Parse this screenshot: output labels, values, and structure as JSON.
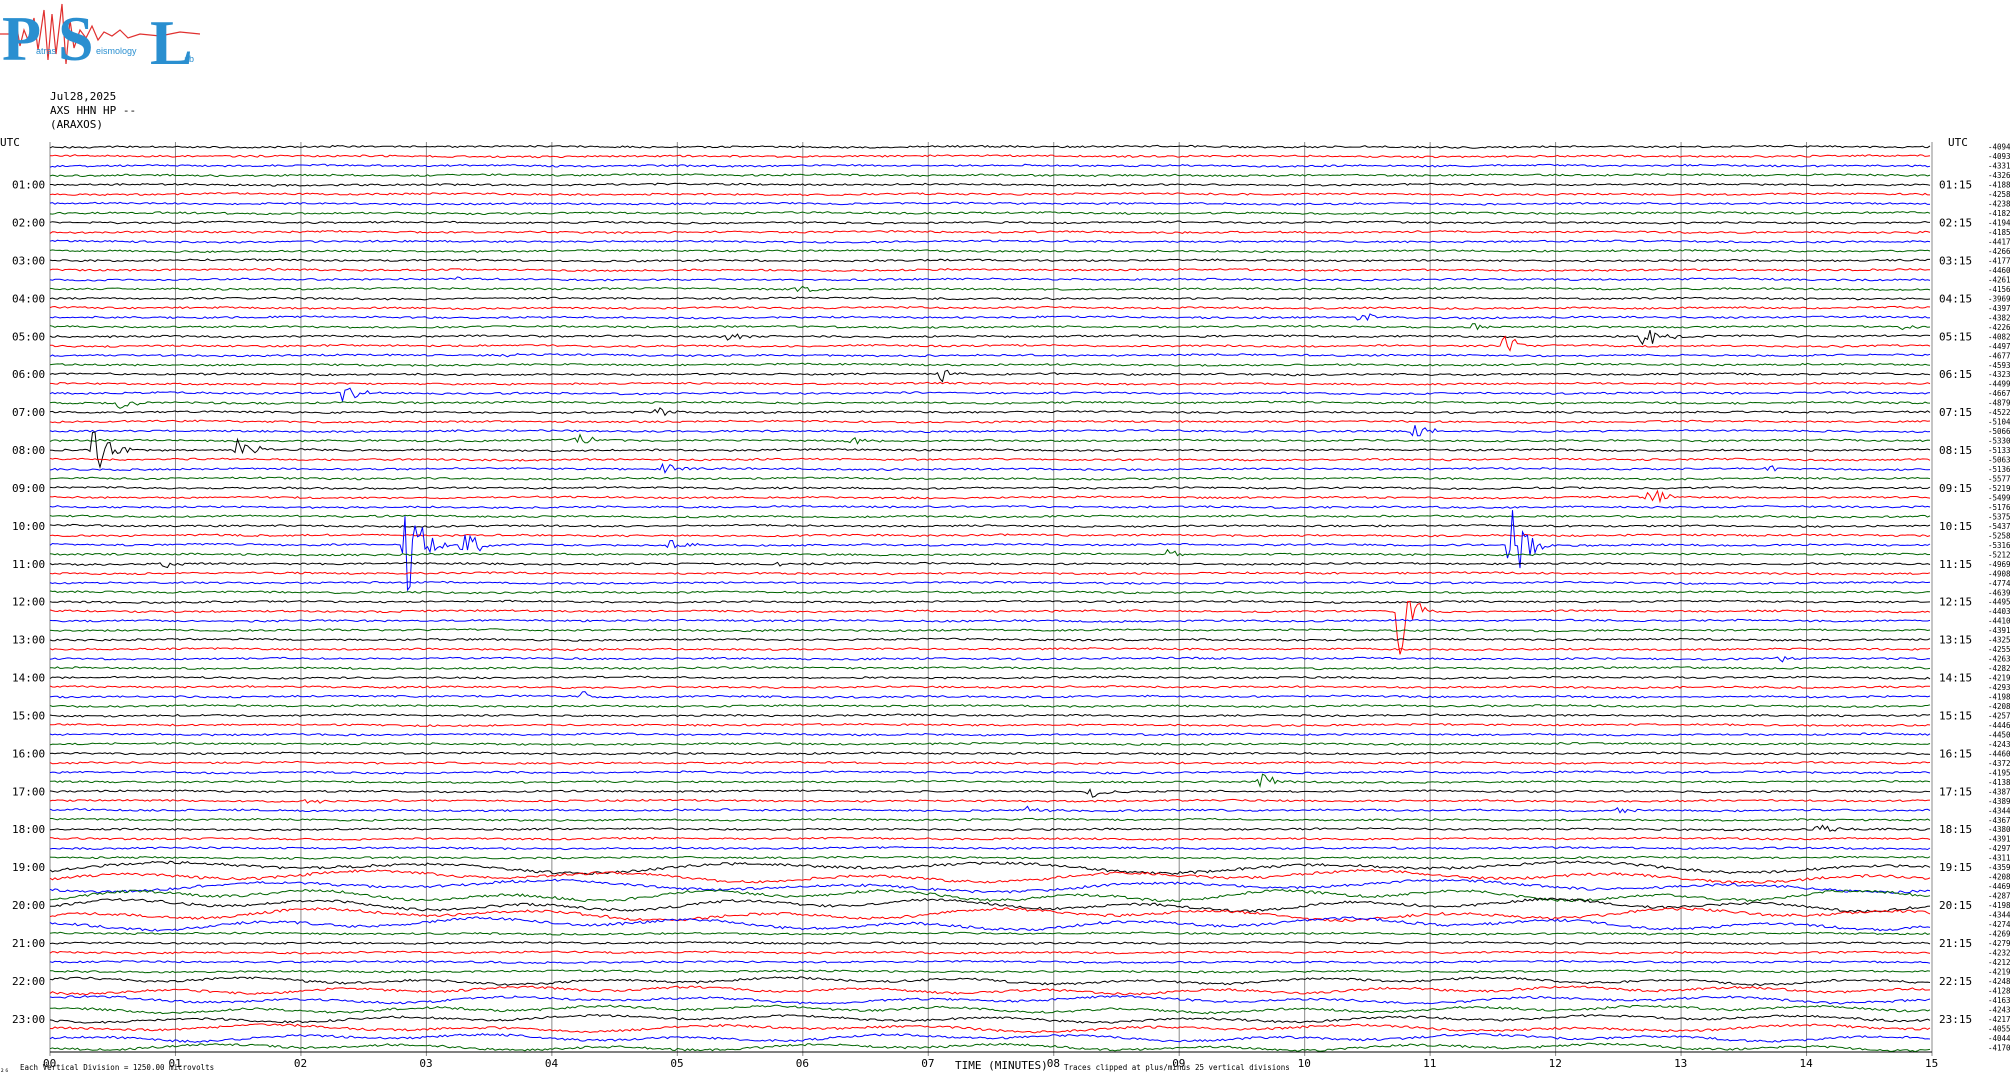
{
  "logo": {
    "letters": [
      "P",
      "S",
      "L"
    ],
    "small_words": [
      "atras",
      "eismology",
      "ab"
    ]
  },
  "header": {
    "date": "Jul28,2025",
    "station": "AXS HHN HP --",
    "location": "(ARAXOS)"
  },
  "chart_data": {
    "type": "line",
    "title": "",
    "xlabel": "TIME (MINUTES)",
    "left_axis_label": "UTC",
    "right_axis_label": "UTC",
    "x_ticks": [
      "00",
      "01",
      "02",
      "03",
      "04",
      "05",
      "06",
      "07",
      "08",
      "09",
      "10",
      "11",
      "12",
      "13",
      "14",
      "15"
    ],
    "xlim": [
      0,
      15
    ],
    "left_hour_labels": [
      "01:00",
      "02:00",
      "03:00",
      "04:00",
      "05:00",
      "06:00",
      "07:00",
      "08:00",
      "09:00",
      "10:00",
      "11:00",
      "12:00",
      "13:00",
      "14:00",
      "15:00",
      "16:00",
      "17:00",
      "18:00",
      "19:00",
      "20:00",
      "21:00",
      "22:00",
      "23:00"
    ],
    "right_hour_labels": [
      "01:15",
      "02:15",
      "03:15",
      "04:15",
      "05:15",
      "06:15",
      "07:15",
      "08:15",
      "09:15",
      "10:15",
      "11:15",
      "12:15",
      "13:15",
      "14:15",
      "15:15",
      "16:15",
      "17:15",
      "18:15",
      "19:15",
      "20:15",
      "21:15",
      "22:15",
      "23:15"
    ],
    "trace_count": 96,
    "trace_minutes": 15,
    "trace_colors": [
      "#000000",
      "#ff0000",
      "#0000ff",
      "#006400"
    ],
    "grid": true,
    "right_offsets": [
      "-4094",
      "-4093",
      "-4331",
      "-4326",
      "-4188",
      "-4258",
      "-4238",
      "-4182",
      "-4194",
      "-4185",
      "-4417",
      "-4266",
      "-4177",
      "-4460",
      "-4261",
      "-4156",
      "-3969",
      "-4397",
      "-4382",
      "-4226",
      "-4082",
      "-4497",
      "-4677",
      "-4593",
      "-4323",
      "-4499",
      "-4667",
      "-4879",
      "-4522",
      "-5104",
      "-5066",
      "-5330",
      "-5133",
      "-5063",
      "-5136",
      "-5577",
      "-5219",
      "-5499",
      "-5176",
      "-5375",
      "-5437",
      "-5258",
      "-5316",
      "-5212",
      "-4969",
      "-4908",
      "-4774",
      "-4639",
      "-4495",
      "-4403",
      "-4410",
      "-4391",
      "-4325",
      "-4255",
      "-4263",
      "-4282",
      "-4219",
      "-4293",
      "-4198",
      "-4208",
      "-4257",
      "-4446",
      "-4450",
      "-4243",
      "-4460",
      "-4372",
      "-4195",
      "-4138",
      "-4387",
      "-4389",
      "-4344",
      "-4367",
      "-4380",
      "-4391",
      "-4297",
      "-4311",
      "-4359",
      "-4208",
      "-4469",
      "-4287",
      "-4198",
      "-4344",
      "-4274",
      "-4269",
      "-4279",
      "-4232",
      "-4212",
      "-4219",
      "-4248",
      "-4128",
      "-4163",
      "-4243",
      "-4217",
      "-4055",
      "-4044",
      "-4170"
    ],
    "events": [
      {
        "trace": 14,
        "minute": 3.25,
        "amp": 0.15
      },
      {
        "trace": 15,
        "minute": 5.95,
        "amp": 0.25
      },
      {
        "trace": 18,
        "minute": 10.45,
        "amp": 0.35
      },
      {
        "trace": 19,
        "minute": 11.35,
        "amp": 0.2
      },
      {
        "trace": 19,
        "minute": 14.7,
        "amp": 0.2
      },
      {
        "trace": 20,
        "minute": 5.4,
        "amp": 0.2
      },
      {
        "trace": 20,
        "minute": 12.7,
        "amp": 0.9
      },
      {
        "trace": 21,
        "minute": 11.6,
        "amp": 0.6
      },
      {
        "trace": 22,
        "minute": 3.6,
        "amp": 0.15
      },
      {
        "trace": 24,
        "minute": 7.1,
        "amp": 0.45
      },
      {
        "trace": 26,
        "minute": 2.35,
        "amp": 0.6
      },
      {
        "trace": 27,
        "minute": 0.55,
        "amp": 0.35
      },
      {
        "trace": 28,
        "minute": 4.85,
        "amp": 0.3
      },
      {
        "trace": 30,
        "minute": 10.85,
        "amp": 0.5
      },
      {
        "trace": 31,
        "minute": 4.2,
        "amp": 0.5
      },
      {
        "trace": 31,
        "minute": 6.4,
        "amp": 0.25
      },
      {
        "trace": 32,
        "minute": 0.35,
        "amp": 1.6
      },
      {
        "trace": 32,
        "minute": 1.5,
        "amp": 0.6
      },
      {
        "trace": 34,
        "minute": 4.9,
        "amp": 0.45
      },
      {
        "trace": 34,
        "minute": 13.7,
        "amp": 0.2
      },
      {
        "trace": 37,
        "minute": 12.75,
        "amp": 0.55
      },
      {
        "trace": 42,
        "minute": 2.85,
        "amp": 3.0
      },
      {
        "trace": 42,
        "minute": 3.3,
        "amp": 0.9
      },
      {
        "trace": 42,
        "minute": 4.95,
        "amp": 0.3
      },
      {
        "trace": 42,
        "minute": 11.65,
        "amp": 2.5
      },
      {
        "trace": 43,
        "minute": 8.9,
        "amp": 0.3
      },
      {
        "trace": 44,
        "minute": 0.9,
        "amp": 0.2
      },
      {
        "trace": 44,
        "minute": 5.8,
        "amp": 0.2
      },
      {
        "trace": 49,
        "minute": 10.75,
        "amp": 2.5
      },
      {
        "trace": 54,
        "minute": 13.8,
        "amp": 0.25
      },
      {
        "trace": 58,
        "minute": 4.25,
        "amp": 0.25
      },
      {
        "trace": 68,
        "minute": 8.3,
        "amp": 0.35
      },
      {
        "trace": 67,
        "minute": 9.65,
        "amp": 0.5
      },
      {
        "trace": 69,
        "minute": 2.05,
        "amp": 0.2
      },
      {
        "trace": 70,
        "minute": 7.8,
        "amp": 0.2
      },
      {
        "trace": 70,
        "minute": 12.5,
        "amp": 0.15
      },
      {
        "trace": 72,
        "minute": 14.1,
        "amp": 0.3
      }
    ]
  },
  "footer": {
    "mark": "₂₆",
    "left_note": "Each Vertical Division = 1250.00 microvolts",
    "center_note": "Traces clipped at plus/minus 25 vertical divisions"
  }
}
